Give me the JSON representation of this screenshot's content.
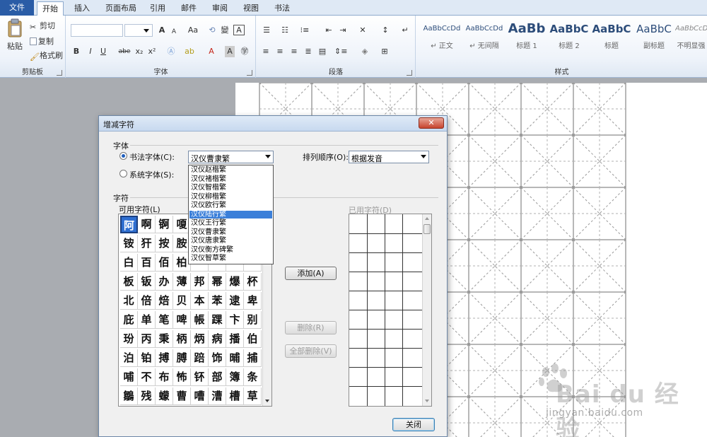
{
  "tabs": [
    "文件",
    "开始",
    "插入",
    "页面布局",
    "引用",
    "邮件",
    "审阅",
    "视图",
    "书法"
  ],
  "ribbon": {
    "clipboard": {
      "paste": "粘贴",
      "cut": "剪切",
      "copy": "复制",
      "format_painter": "格式刷",
      "label": "剪贴板"
    },
    "font": {
      "label": "字体",
      "grow": "A",
      "shrink": "A",
      "change_case": "Aa",
      "bold": "B",
      "italic": "I",
      "underline": "U",
      "strike": "abe",
      "subscript": "x₂",
      "superscript": "x²",
      "font_color": "A"
    },
    "paragraph": {
      "label": "段落"
    },
    "styles": {
      "label": "样式",
      "items": [
        {
          "sample": "AaBbCcDd",
          "name": "↵ 正文"
        },
        {
          "sample": "AaBbCcDd",
          "name": "↵ 无间隔"
        },
        {
          "sample": "AaBb",
          "name": "标题 1"
        },
        {
          "sample": "AaBbC",
          "name": "标题 2"
        },
        {
          "sample": "AaBbC",
          "name": "标题"
        },
        {
          "sample": "AaBbC",
          "name": "副标题"
        },
        {
          "sample": "AaBbCcDd",
          "name": "不明显强"
        }
      ]
    }
  },
  "dialog": {
    "title": "增减字符",
    "close": "✕",
    "font_section": "字体",
    "calligraphy_font_label": "书法字体(C):",
    "system_font_label": "系统字体(S):",
    "font_combo_value": "汉仪曹隶繁",
    "sort_label": "排列顺序(O):",
    "sort_value": "根据发音",
    "font_options": [
      "汉仪赵楷繁",
      "汉仪褚楷繁",
      "汉仪智楷繁",
      "汉仪柳楷繁",
      "汉仪欧行繁",
      "汉仪陆行繁",
      "汉仪王行繁",
      "汉仪曹隶繁",
      "汉仪唐隶繁",
      "汉仪衡方碑繁",
      "汉仪智草繁"
    ],
    "selected_font_option": "汉仪陆行繁",
    "chars_section": "字符",
    "available_label": "可用字符(L)",
    "used_label": "已用字符(D)",
    "available_chars": [
      [
        "阿",
        "啊",
        "锕",
        "嗄",
        "",
        "",
        "",
        ""
      ],
      [
        "铵",
        "犴",
        "按",
        "胺",
        "",
        "",
        "",
        ""
      ],
      [
        "白",
        "百",
        "佰",
        "柏",
        "",
        "",
        "",
        ""
      ],
      [
        "板",
        "钣",
        "办",
        "薄",
        "邦",
        "幂",
        "爆",
        "杯"
      ],
      [
        "北",
        "倍",
        "焙",
        "贝",
        "本",
        "苯",
        "逮",
        "卑"
      ],
      [
        "庇",
        "单",
        "笔",
        "啤",
        "帳",
        "踝",
        "卞",
        "别"
      ],
      [
        "玢",
        "丙",
        "秉",
        "柄",
        "炳",
        "病",
        "播",
        "伯"
      ],
      [
        "泊",
        "铂",
        "搏",
        "膊",
        "踣",
        "饰",
        "晡",
        "捕"
      ],
      [
        "哺",
        "不",
        "布",
        "怖",
        "钚",
        "部",
        "簿",
        "条"
      ],
      [
        "鶵",
        "残",
        "蠓",
        "曹",
        "嘈",
        "漕",
        "槽",
        "草"
      ]
    ],
    "add_button": "添加(A)",
    "delete_button": "删除(R)",
    "delete_all_button": "全部删除(V)",
    "close_button": "关闭"
  },
  "watermark": {
    "logo": "Bai du 经验",
    "url": "jingyan.baidu.com"
  }
}
